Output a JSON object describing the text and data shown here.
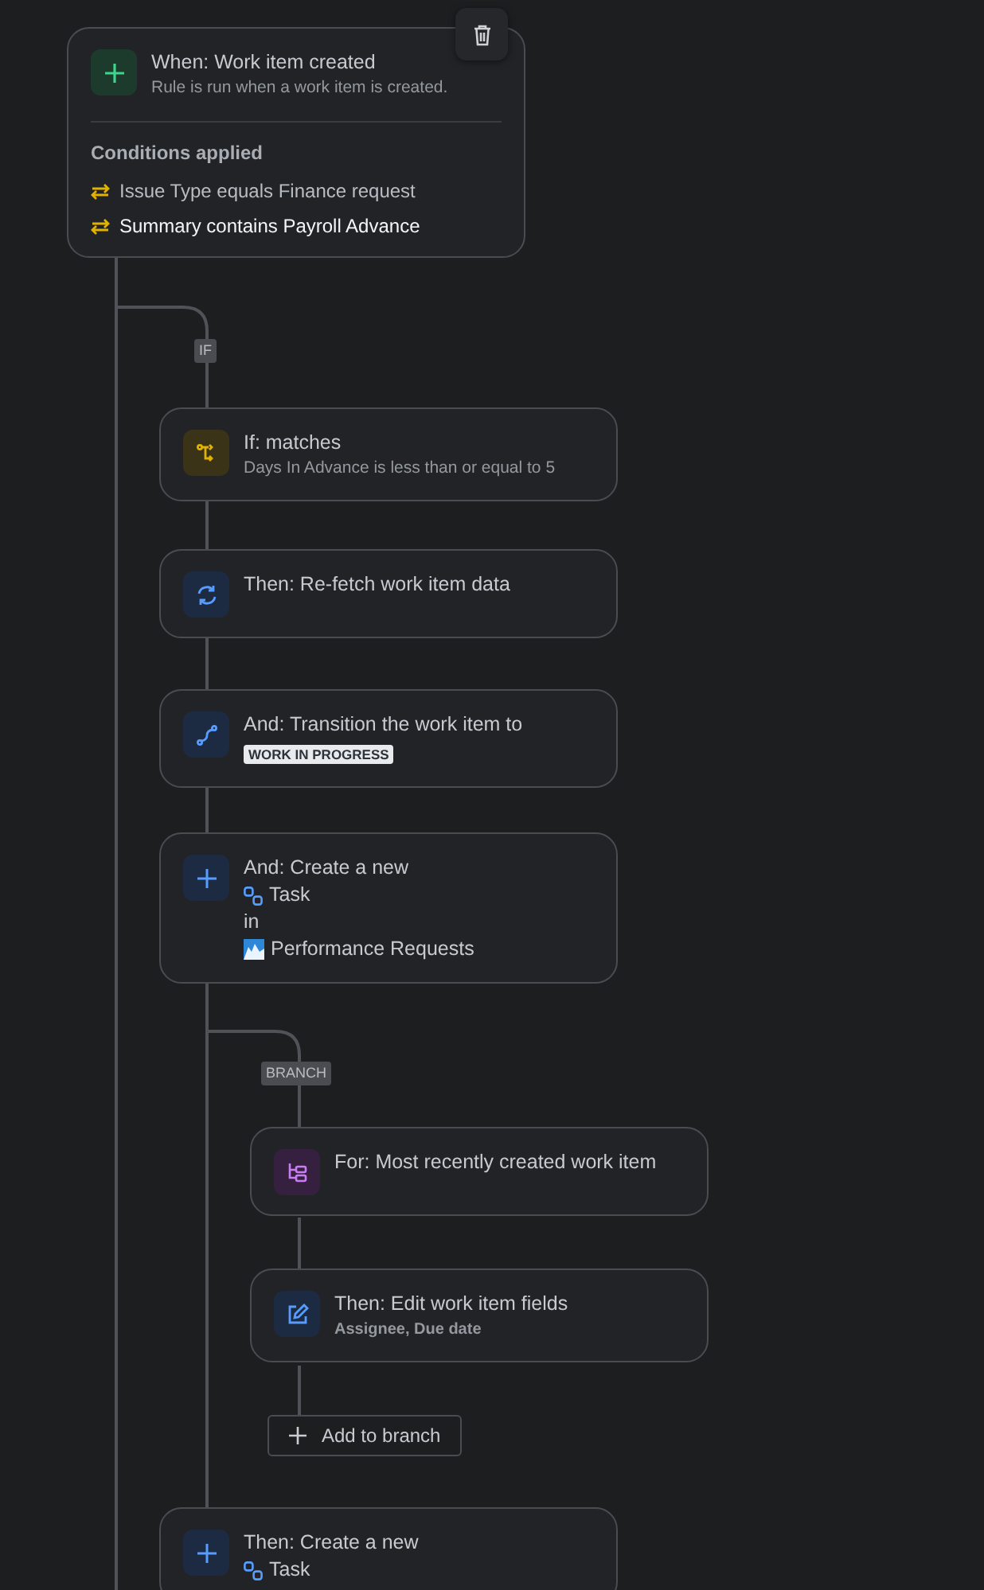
{
  "trigger": {
    "title": "When: Work item created",
    "description": "Rule is run when a work item is created.",
    "conditions_heading": "Conditions applied",
    "conditions": [
      {
        "text": "Issue Type equals Finance request",
        "highlighted": false
      },
      {
        "text": "Summary contains Payroll Advance",
        "highlighted": true
      }
    ]
  },
  "if_label": "IF",
  "steps": [
    {
      "kind": "condition",
      "title": "If: matches",
      "subtitle": "Days In Advance is less than or equal to 5"
    },
    {
      "kind": "refetch",
      "title": "Then: Re-fetch work item data"
    },
    {
      "kind": "transition",
      "title": "And: Transition the work item to",
      "status": "WORK IN PROGRESS"
    },
    {
      "kind": "create",
      "title": "And: Create a new",
      "issue_type": "Task",
      "connector": "in",
      "project": "Performance Requests"
    }
  ],
  "branch_label": "BRANCH",
  "branch_steps": [
    {
      "kind": "for",
      "title": "For: Most recently created work item"
    },
    {
      "kind": "edit",
      "title": "Then: Edit work item fields",
      "subtitle": "Assignee, Due date"
    }
  ],
  "add_to_branch": "Add to branch",
  "final_steps": [
    {
      "kind": "create",
      "title": "Then: Create a new",
      "issue_type": "Task"
    }
  ]
}
